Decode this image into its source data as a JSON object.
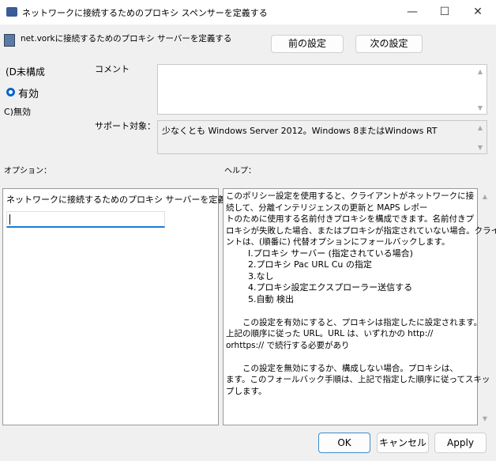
{
  "window": {
    "title": "ネットワークに接続するためのプロキシ スペンサーを定義する",
    "controls": {
      "minimize": "—",
      "maximize": "☐",
      "close": "✕"
    }
  },
  "header": {
    "policy_name": "net.vorkに接続するためのプロキシ サーバーを定義する",
    "prev_button": "前の設定",
    "next_button": "次の設定"
  },
  "state": {
    "not_configured": "(D未構成",
    "enabled": "有効",
    "disabled": "C)無効",
    "selected": "enabled"
  },
  "comment": {
    "label": "コメント",
    "value": ""
  },
  "supported": {
    "label": "サポート対象：",
    "value": "少なくとも Windows Server 2012。Windows 8またはWindows RT"
  },
  "options": {
    "label": "オプション：",
    "field_label": "ネットワークに接続するためのプロキシ サーバーを定義する",
    "field_value": ""
  },
  "help": {
    "label": "ヘルプ：",
    "lines": [
      "このポリシー設定を使用すると、クライアントがネットワークに接",
      "続して、分離インテリジェンスの更新と MAPS レポー",
      "トのために使用する名前付きプロキシを構成できます。名前付きプ",
      "ロキシが失敗した場合、またはプロキシが指定されていない場合。クライア",
      "ントは、(順番に) 代替オプションにフォールバックします。"
    ],
    "items": [
      "I.プロキシ サーバー (指定されている場合)",
      "2.プロキシ Pac URL Cu の指定",
      "3.なし",
      "4.プロキシ設定エクスプローラー送信する",
      "5.自動 検出"
    ],
    "para2": [
      "　　この設定を有効にすると、プロキシは指定したに設定されます。",
      "上記の順序に従った URL。URL は、いずれかの http://",
      "orhttps:// で続行する必要があり"
    ],
    "para3": [
      "　　この設定を無効にするか、構成しない場合。プロキシは、",
      "ます。このフォールバック手順は、上記で指定した順序に従ってスキッ",
      "プします。"
    ]
  },
  "footer": {
    "ok": "OK",
    "cancel": "キャンセル",
    "apply": "Apply"
  }
}
